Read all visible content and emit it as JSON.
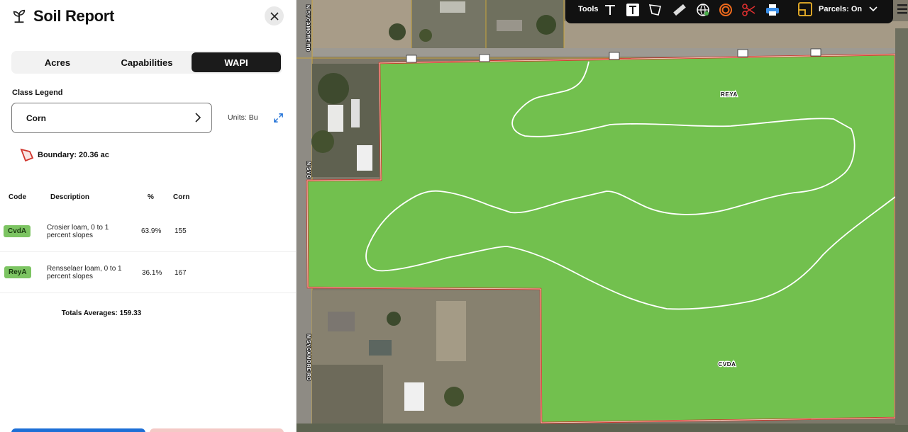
{
  "panel": {
    "title": "Soil Report",
    "tabs": [
      {
        "label": "Acres",
        "active": false
      },
      {
        "label": "Capabilities",
        "active": false
      },
      {
        "label": "WAPI",
        "active": true
      }
    ],
    "legend_label": "Class Legend",
    "crop": "Corn",
    "units": "Units: Bu",
    "boundary": "Boundary: 20.36 ac",
    "table": {
      "headers": {
        "code": "Code",
        "description": "Description",
        "percent": "%",
        "corn": "Corn"
      },
      "rows": [
        {
          "code": "CvdA",
          "description": "Crosier loam, 0 to 1 percent slopes",
          "percent": "63.9%",
          "corn": "155"
        },
        {
          "code": "ReyA",
          "description": "Rensselaer loam, 0 to 1 percent slopes",
          "percent": "36.1%",
          "corn": "167"
        }
      ],
      "totals": "Totals Averages: 159.33"
    },
    "badge_color": "#7cc462"
  },
  "toolbar": {
    "tools_label": "Tools",
    "parcels_label": "Parcels: On",
    "icons": [
      "text-tool-icon",
      "text-box-tool-icon",
      "polygon-tool-icon",
      "ruler-icon",
      "globe-icon",
      "target-icon",
      "scissors-icon",
      "print-icon",
      "parcels-icon",
      "chevron-down-icon"
    ]
  },
  "map": {
    "road_labels": [
      "N SYCAMORE RD",
      "N SYC",
      "N SYCAMORE RD"
    ],
    "soil_labels": [
      "REYA",
      "CVDA"
    ],
    "field_color": "#72c04e",
    "boundary_color": "#d0342c"
  }
}
